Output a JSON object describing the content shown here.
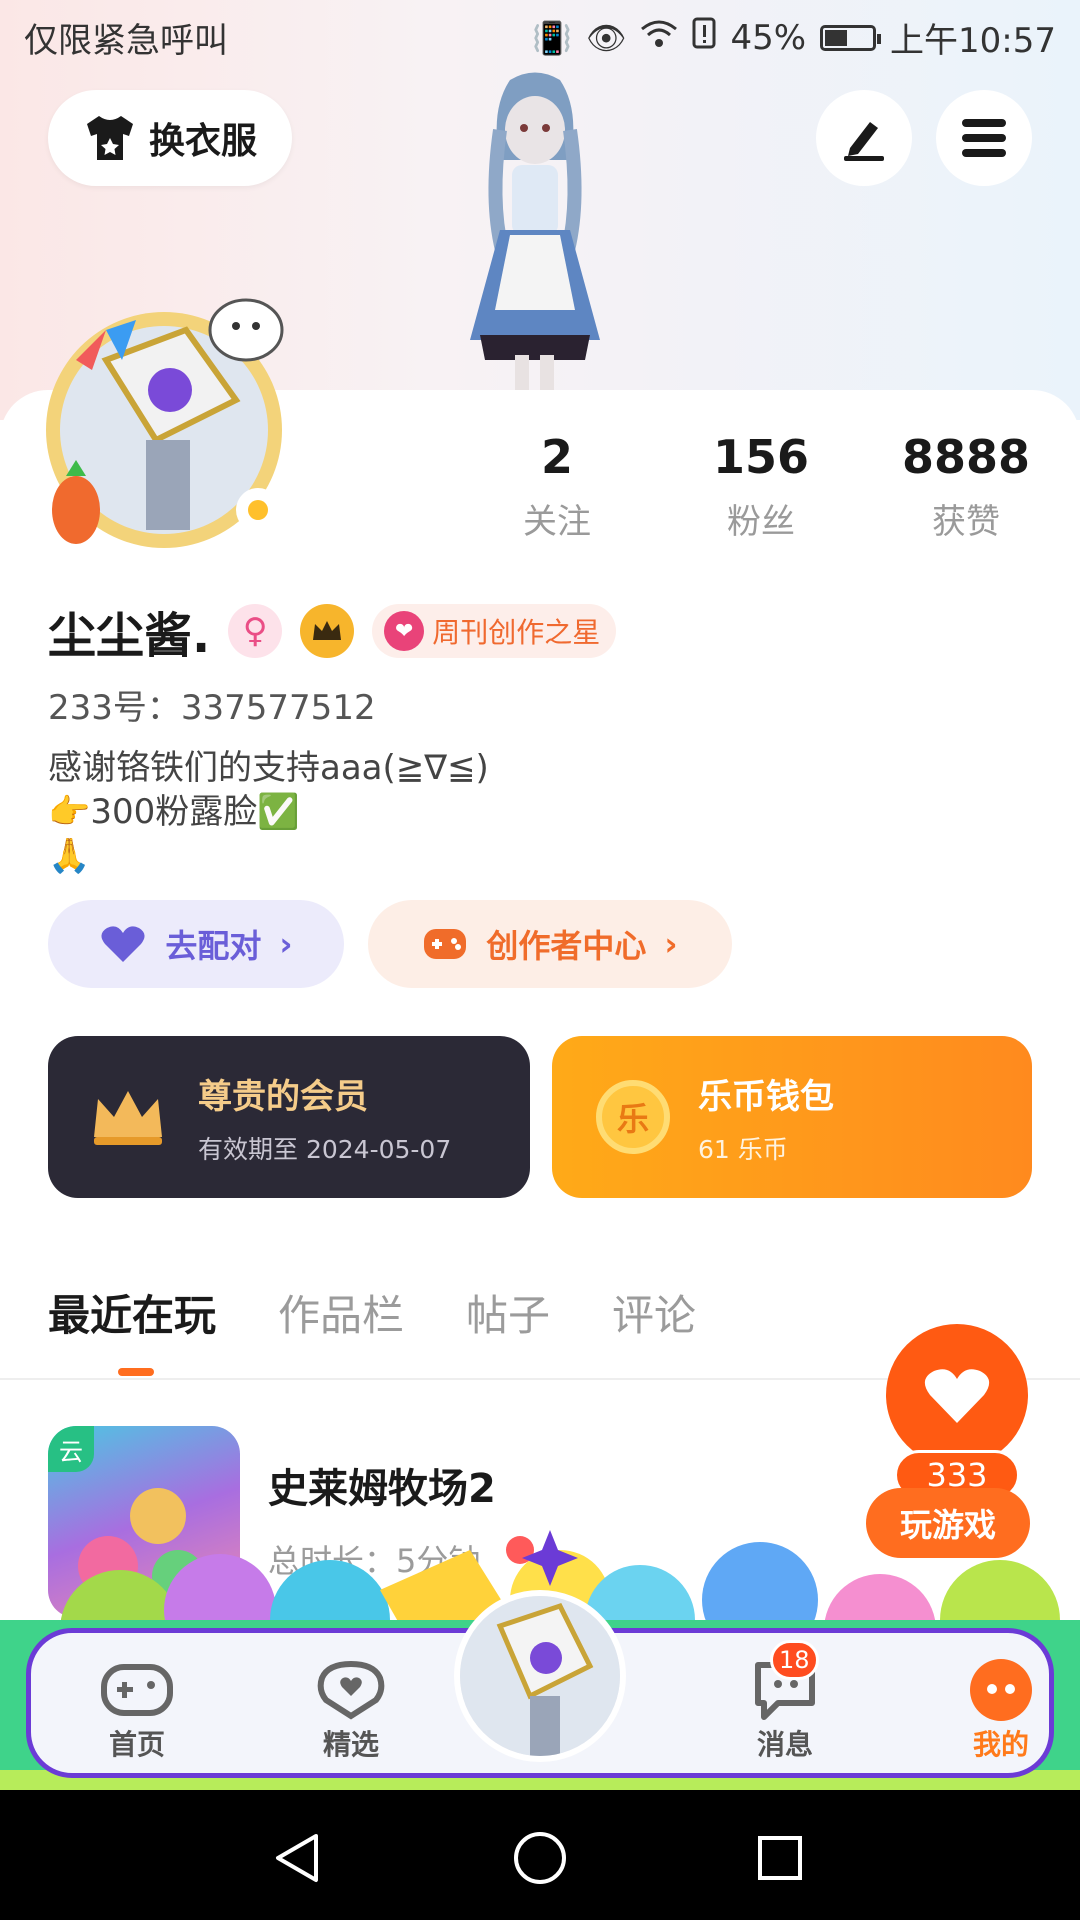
{
  "status_bar": {
    "left_text": "仅限紧急呼叫",
    "battery": "45%",
    "time": "上午10:57"
  },
  "header": {
    "outfit_label": "换衣服"
  },
  "stats": [
    {
      "value": "2",
      "label": "关注"
    },
    {
      "value": "156",
      "label": "粉丝"
    },
    {
      "value": "8888",
      "label": "获赞"
    }
  ],
  "profile": {
    "name": "尘尘酱.",
    "badge": "周刊创作之星",
    "id_line": "233号：337577512",
    "bio": [
      "感谢铬铁们的支持aaa(≧∇≦)",
      "👉300粉露脸✅",
      "🙏"
    ]
  },
  "actions": {
    "match_label": "去配对",
    "creator_label": "创作者中心"
  },
  "cards": {
    "vip_title": "尊贵的会员",
    "vip_sub": "有效期至 2024-05-07",
    "wallet_title": "乐币钱包",
    "wallet_sub": "61 乐币",
    "coin_glyph": "乐"
  },
  "tabs": [
    "最近在玩",
    "作品栏",
    "帖子",
    "评论"
  ],
  "recent_game": {
    "cloud_tag": "云",
    "title": "史莱姆牧场2",
    "duration": "总时长：5分钟"
  },
  "float": {
    "like_count": "333",
    "play_label": "玩游戏"
  },
  "bottom_nav": {
    "items": [
      "首页",
      "精选",
      "消息",
      "我的"
    ],
    "message_badge": "18"
  },
  "colors": {
    "accent": "#ff6d1f",
    "vip_bg": "#2b2936",
    "nav_border": "#6b3bd6"
  }
}
